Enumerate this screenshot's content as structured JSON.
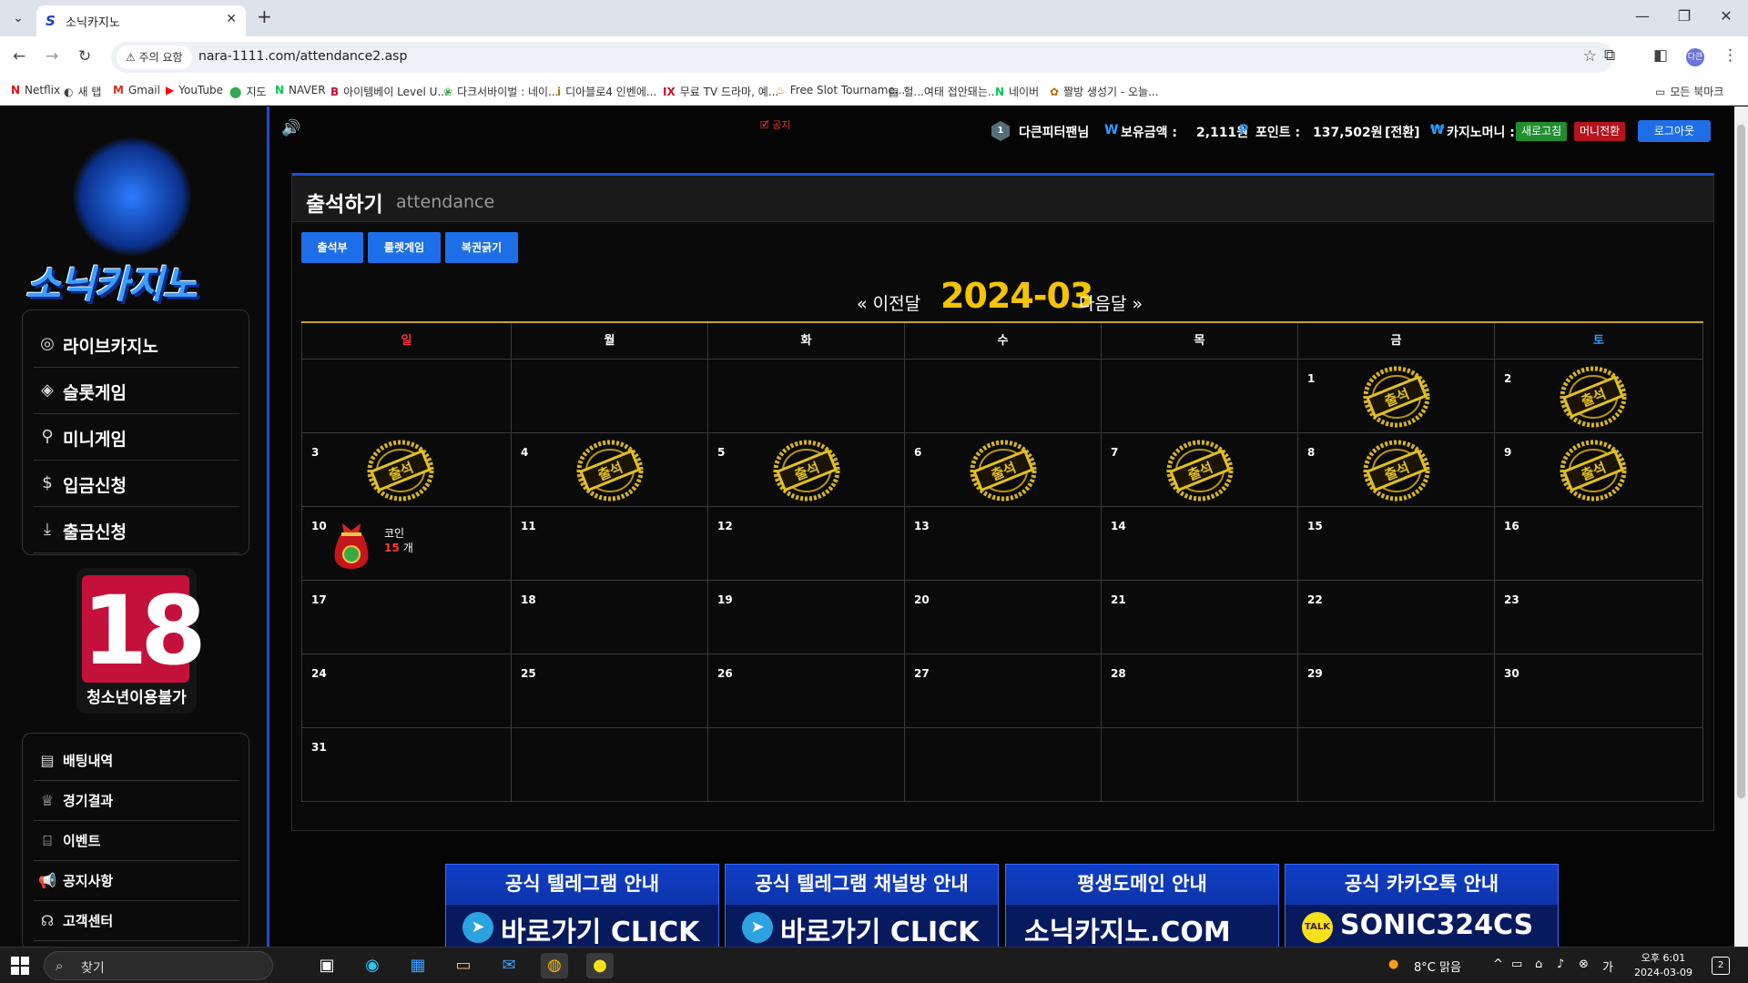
{
  "browser": {
    "tab_title": "소닉카지노",
    "security_label": "주의 요함",
    "url": "nara-1111.com/attendance2.asp",
    "profile_initials": "다큰",
    "bookmarks": [
      {
        "label": "Netflix",
        "icon": "N"
      },
      {
        "label": "새 탭",
        "icon": "◐"
      },
      {
        "label": "Gmail",
        "icon": "M"
      },
      {
        "label": "YouTube",
        "icon": "▶"
      },
      {
        "label": "지도",
        "icon": "⬤"
      },
      {
        "label": "NAVER",
        "icon": "N"
      },
      {
        "label": "아이템베이 Level U...",
        "icon": "B"
      },
      {
        "label": "다크서바이벌 : 네이...",
        "icon": "❀"
      },
      {
        "label": "디아블로4 인벤에...",
        "icon": "i"
      },
      {
        "label": "무료 TV 드라마, 예...",
        "icon": "IX"
      },
      {
        "label": "Free Slot Tourname...",
        "icon": "♨"
      },
      {
        "label": "헐...여태 접안돼는...",
        "icon": "▤"
      },
      {
        "label": "네이버",
        "icon": "N"
      },
      {
        "label": "짤방 생성기 - 오늘...",
        "icon": "✿"
      }
    ],
    "all_bookmarks": "모든 북마크"
  },
  "sidebar": {
    "logo_text": "소닉카지노",
    "main_menu": [
      {
        "label": "라이브카지노",
        "icon": "chip-icon"
      },
      {
        "label": "슬롯게임",
        "icon": "diamond-icon"
      },
      {
        "label": "미니게임",
        "icon": "joystick-icon"
      },
      {
        "label": "입금신청",
        "icon": "coin-icon"
      },
      {
        "label": "출금신청",
        "icon": "download-icon"
      }
    ],
    "age_badge_number": "18",
    "age_badge_label": "청소년이용불가",
    "sub_menu": [
      {
        "label": "배팅내역",
        "icon": "receipt-icon"
      },
      {
        "label": "경기결과",
        "icon": "trophy-icon"
      },
      {
        "label": "이벤트",
        "icon": "gift-icon"
      },
      {
        "label": "공지사항",
        "icon": "megaphone-icon"
      },
      {
        "label": "고객센터",
        "icon": "headset-icon"
      }
    ]
  },
  "header": {
    "notice": "🗹 공지",
    "user_level": "1",
    "username": "다큰피터팬님",
    "balance_label": "보유금액 :",
    "balance_value": "2,111원",
    "points_label": "포인트 :",
    "points_value": "137,502원",
    "points_convert": "[전환]",
    "casino_money_label": "카지노머니 : 0",
    "refresh_button": "새로고침",
    "money_convert_button": "머니전환",
    "logout_button": "로그아웃"
  },
  "attendance": {
    "title": "출석하기",
    "subtitle": "attendance",
    "tabs": [
      "출석부",
      "룰렛게임",
      "복권긁기"
    ],
    "prev_month": "« 이전달",
    "current_month": "2024-03",
    "next_month": "다음달 »",
    "weekdays": [
      "일",
      "월",
      "화",
      "수",
      "목",
      "금",
      "토"
    ],
    "weekday_colors": [
      "#ff3333",
      "#ffffff",
      "#ffffff",
      "#ffffff",
      "#ffffff",
      "#ffffff",
      "#2f9bff"
    ],
    "stamp_text": "출석",
    "coin_label": "코인",
    "coin_count": "15",
    "coin_unit": "개",
    "weeks": [
      [
        "",
        "",
        "",
        "",
        "",
        "1",
        "2"
      ],
      [
        "3",
        "4",
        "5",
        "6",
        "7",
        "8",
        "9"
      ],
      [
        "10",
        "11",
        "12",
        "13",
        "14",
        "15",
        "16"
      ],
      [
        "17",
        "18",
        "19",
        "20",
        "21",
        "22",
        "23"
      ],
      [
        "24",
        "25",
        "26",
        "27",
        "28",
        "29",
        "30"
      ],
      [
        "31",
        "",
        "",
        "",
        "",
        "",
        ""
      ]
    ],
    "stamped_days": [
      "1",
      "2",
      "3",
      "4",
      "5",
      "6",
      "7",
      "8",
      "9"
    ],
    "coin_day": "10"
  },
  "banners": [
    {
      "title": "공식 텔레그램 안내",
      "cta": "바로가기 CLICK",
      "icon": "telegram-icon"
    },
    {
      "title": "공식 텔레그램 채널방 안내",
      "cta": "바로가기 CLICK",
      "icon": "telegram-icon"
    },
    {
      "title": "평생도메인 안내",
      "cta": "소닉카지노.COM",
      "icon": ""
    },
    {
      "title": "공식 카카오톡 안내",
      "cta": "SONIC324CS",
      "icon": "kakaotalk-icon"
    }
  ],
  "taskbar": {
    "search_placeholder": "찾기",
    "weather": "8°C 맑음",
    "time": "오후 6:01",
    "date": "2024-03-09",
    "notification_count": "2"
  },
  "colors": {
    "accent_blue": "#1e6ee8",
    "gold": "#f5c400",
    "refresh_green": "#1f8f2e",
    "convert_red": "#b3141e"
  }
}
